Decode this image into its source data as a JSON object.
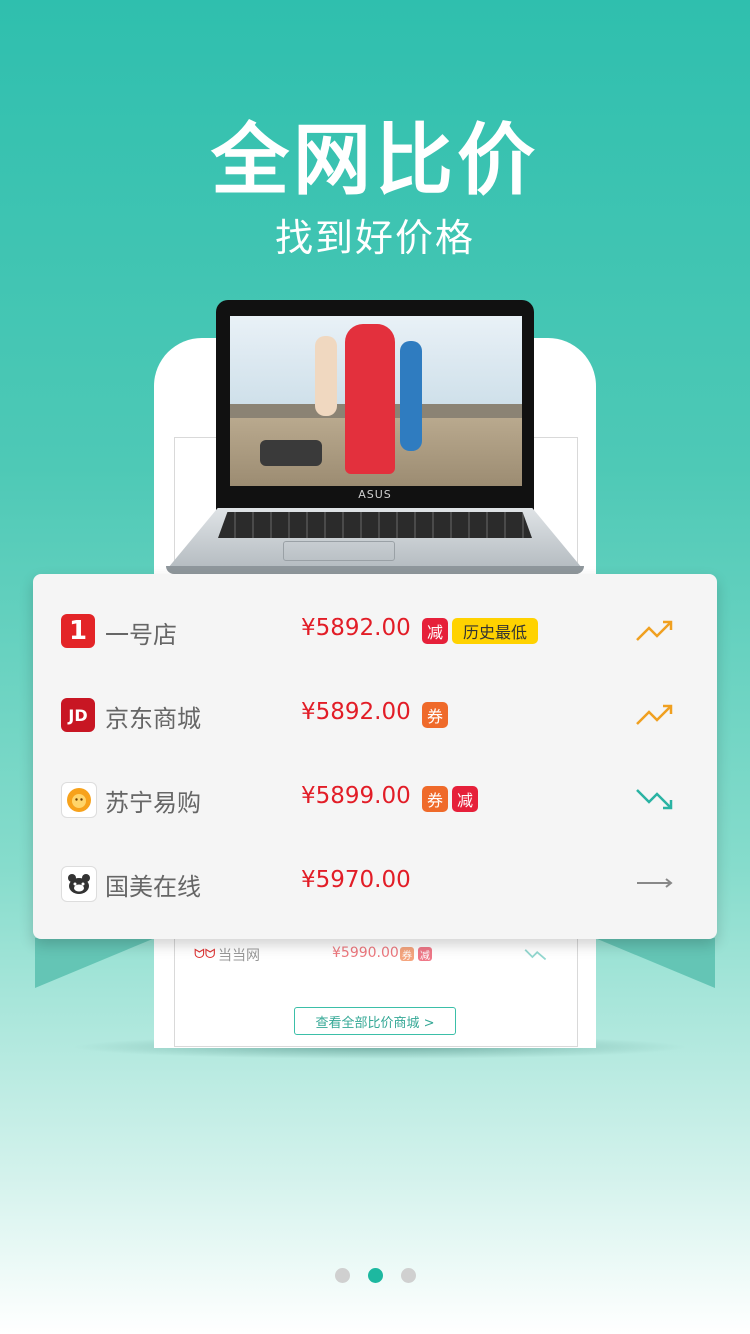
{
  "header": {
    "title": "全网比价",
    "subtitle": "找到好价格"
  },
  "laptop": {
    "brand": "ASUS"
  },
  "stores": [
    {
      "logo_text": "1",
      "name": "一号店",
      "price": "¥5892.00",
      "badges": [
        "减",
        "历史最低"
      ],
      "trend": "up"
    },
    {
      "logo_text": "JD",
      "name": "京东商城",
      "price": "¥5892.00",
      "badges": [
        "券"
      ],
      "trend": "up"
    },
    {
      "logo_text": "",
      "name": "苏宁易购",
      "price": "¥5899.00",
      "badges": [
        "券",
        "减"
      ],
      "trend": "down"
    },
    {
      "logo_text": "",
      "name": "国美在线",
      "price": "¥5970.00",
      "badges": [],
      "trend": "flat"
    }
  ],
  "behind_row": {
    "name": "当当网",
    "price": "¥5990.00",
    "badges": [
      "券",
      "减"
    ],
    "trend": "down"
  },
  "view_all_label": "查看全部比价商城 >",
  "pager": {
    "count": 3,
    "active": 2
  },
  "colors": {
    "accent": "#1db8a0",
    "price": "#e21d27",
    "up": "#f0a020",
    "down": "#2ab3a3",
    "flat": "#888888"
  }
}
